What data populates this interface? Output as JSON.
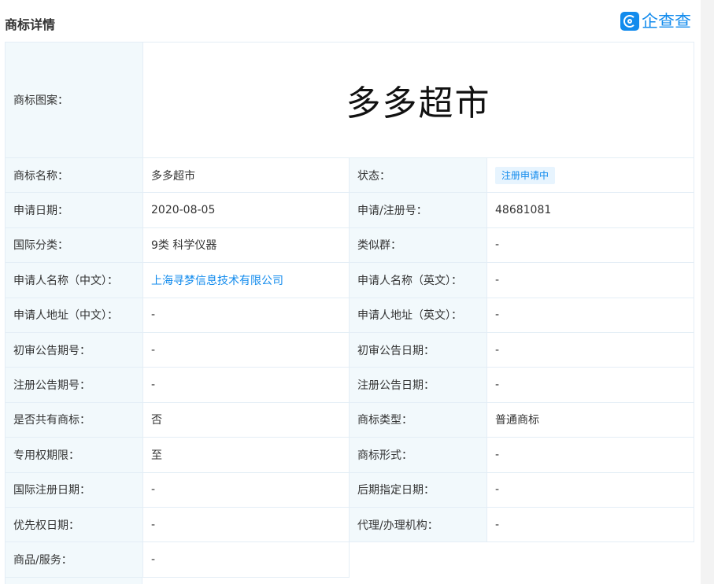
{
  "header": {
    "title": "商标详情",
    "logo_text": "企查查"
  },
  "mark_image_text": "多多超市",
  "labels": {
    "mark_image": "商标图案：",
    "name": "商标名称：",
    "status": "状态：",
    "apply_date": "申请日期：",
    "reg_no": "申请/注册号：",
    "intl_class": "国际分类：",
    "similar_group": "类似群：",
    "applicant_cn": "申请人名称（中文）：",
    "applicant_en": "申请人名称（英文）：",
    "address_cn": "申请人地址（中文）：",
    "address_en": "申请人地址（英文）：",
    "prelim_no": "初审公告期号：",
    "prelim_date": "初审公告日期：",
    "reg_notice_no": "注册公告期号：",
    "reg_notice_date": "注册公告日期：",
    "shared": "是否共有商标：",
    "mark_type": "商标类型：",
    "exclusive_period": "专用权期限：",
    "mark_form": "商标形式：",
    "intl_reg_date": "国际注册日期：",
    "later_date": "后期指定日期：",
    "priority_date": "优先权日期：",
    "agency": "代理/办理机构：",
    "goods": "商品/服务："
  },
  "values": {
    "name": "多多超市",
    "status": "注册申请中",
    "apply_date": "2020-08-05",
    "reg_no": "48681081",
    "intl_class": "9类 科学仪器",
    "similar_group": "-",
    "applicant_cn": "上海寻梦信息技术有限公司",
    "applicant_en": "-",
    "address_cn": "-",
    "address_en": "-",
    "prelim_no": "-",
    "prelim_date": "-",
    "reg_notice_no": "-",
    "reg_notice_date": "-",
    "shared": "否",
    "mark_type": "普通商标",
    "exclusive_period": "至",
    "mark_form": "-",
    "intl_reg_date": "-",
    "later_date": "-",
    "priority_date": "-",
    "agency": "-",
    "goods": "-"
  },
  "colors": {
    "accent": "#128bed",
    "label_bg": "#f2f9fc",
    "border": "#e4eef6"
  }
}
